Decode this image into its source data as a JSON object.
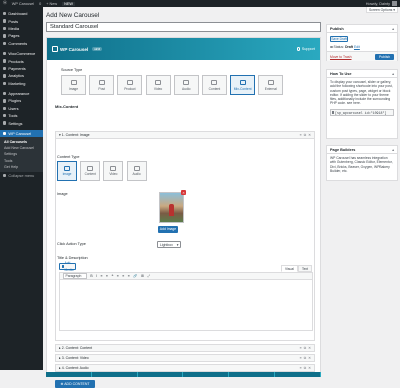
{
  "adminbar": {
    "site": "WP Carousel",
    "comments": "0",
    "new": "+ New",
    "new_badge": "NEW",
    "howdy": "Howdy, Dainty"
  },
  "sidebar": {
    "items": [
      {
        "label": "Dashboard",
        "icon": "dashboard-icon"
      },
      {
        "label": "Posts",
        "icon": "pin-icon"
      },
      {
        "label": "Media",
        "icon": "media-icon"
      },
      {
        "label": "Pages",
        "icon": "pages-icon"
      },
      {
        "label": "Comments",
        "icon": "comments-icon"
      },
      {
        "label": "WooCommerce",
        "icon": "woocommerce-icon"
      },
      {
        "label": "Products",
        "icon": "products-icon"
      },
      {
        "label": "Payments",
        "icon": "payments-icon"
      },
      {
        "label": "Analytics",
        "icon": "analytics-icon"
      },
      {
        "label": "Marketing",
        "icon": "marketing-icon"
      },
      {
        "label": "Appearance",
        "icon": "appearance-icon"
      },
      {
        "label": "Plugins",
        "icon": "plugins-icon"
      },
      {
        "label": "Users",
        "icon": "users-icon"
      },
      {
        "label": "Tools",
        "icon": "tools-icon"
      },
      {
        "label": "Settings",
        "icon": "settings-icon"
      }
    ],
    "active": {
      "label": "WP Carousel",
      "icon": "carousel-icon"
    },
    "sub": [
      "All Carousels",
      "Add New Carousel",
      "Settings",
      "Tools",
      "Get Help"
    ],
    "collapse": "Collapse menu"
  },
  "screen_options": "Screen Options ▾",
  "page_title": "Add New Carousel",
  "title_value": "Standard Carousel",
  "wpc": {
    "logo": "WP Carousel",
    "version": "v2.6",
    "support": "Support",
    "source_type_label": "Source Type",
    "source_types": [
      {
        "label": "Image",
        "icon": "image-icon"
      },
      {
        "label": "Post",
        "icon": "post-icon"
      },
      {
        "label": "Product",
        "icon": "product-icon"
      },
      {
        "label": "Video",
        "icon": "video-icon"
      },
      {
        "label": "Audio",
        "icon": "audio-icon"
      },
      {
        "label": "Content",
        "icon": "content-icon"
      },
      {
        "label": "Mix-Content",
        "icon": "mix-content-icon"
      },
      {
        "label": "External",
        "icon": "external-icon"
      }
    ],
    "active_source": "Mix-Content",
    "mix_label": "Mix-Content",
    "item_open": "▾ 1. Content: Image",
    "content_type_label": "Content Type",
    "content_types": [
      {
        "label": "Image",
        "icon": "image-icon"
      },
      {
        "label": "Content",
        "icon": "content-icon"
      },
      {
        "label": "Video",
        "icon": "video-icon"
      },
      {
        "label": "Audio",
        "icon": "audio-icon"
      }
    ],
    "active_content_type": "Image",
    "image_label": "Image",
    "remove": "×",
    "add_image": "Add Image",
    "click_action_label": "Click Action Type",
    "click_action_value": "Lightbox",
    "title_desc_label": "Title & Description",
    "add_media": "Add Media",
    "tab_visual": "Visual",
    "tab_text": "Text",
    "format_select": "Paragraph",
    "toolbar_glyphs": [
      "B",
      "I",
      "≡",
      "≡",
      "❝",
      "≡",
      "≡",
      "≡",
      "🔗",
      "⊞",
      "⤢"
    ],
    "items_closed": [
      "▸ 2. Content: Content",
      "▸ 3. Content: Video",
      "▸ 4. Content: Audio"
    ],
    "item_controls": [
      "≡",
      "⧉",
      "✕"
    ],
    "add_content": "⊕ ADD CONTENT"
  },
  "publish": {
    "title": "Publish",
    "save_draft": "Save Draft",
    "status_label": "Status:",
    "status_value": "Draft",
    "status_edit": "Edit",
    "trash": "Move to Trash",
    "publish": "Publish"
  },
  "howto": {
    "title": "How To Use",
    "text": "To display your carousel, slider or gallery, add the following shortcode into your post, custom post types, page, widget or block editor. If adding the slider to your theme files, additionally include the surrounding PHP code. see here.",
    "shortcode": "[sp_wpcarousel id=\"10918\"]"
  },
  "builders": {
    "title": "Page Builders",
    "text": "WP Carousel has seamless integration with Gutenberg, Classic Editor, Elementor, Divi, Bricks, Beaver, Oxygen, WPBakery Builder, etc."
  }
}
